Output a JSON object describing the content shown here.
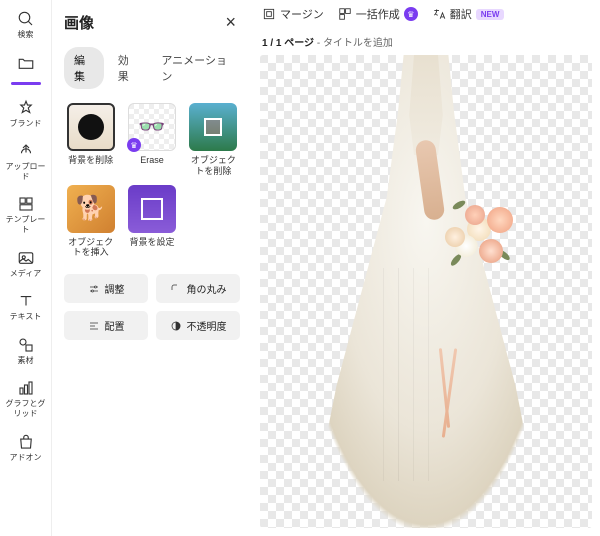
{
  "rail": {
    "items": [
      {
        "label": "検索"
      },
      {
        "label": ""
      },
      {
        "label": "ブランド"
      },
      {
        "label": "アップロード"
      },
      {
        "label": "テンプレート"
      },
      {
        "label": "メディア"
      },
      {
        "label": "テキスト"
      },
      {
        "label": "素材"
      },
      {
        "label": "グラフとグリッド"
      },
      {
        "label": "アドオン"
      }
    ]
  },
  "panel": {
    "title": "画像",
    "tabs": [
      {
        "label": "編集",
        "active": true
      },
      {
        "label": "効果",
        "active": false
      },
      {
        "label": "アニメーション",
        "active": false
      }
    ],
    "tools": [
      {
        "label": "背景を削除",
        "premium": false
      },
      {
        "label": "Erase",
        "premium": true
      },
      {
        "label": "オブジェクトを削除",
        "premium": false
      },
      {
        "label": "オブジェクトを挿入",
        "premium": false
      },
      {
        "label": "背景を設定",
        "premium": false
      }
    ],
    "buttons": {
      "adjust": "調整",
      "corner": "角の丸み",
      "align": "配置",
      "opacity": "不透明度"
    }
  },
  "topbar": {
    "margin": "マージン",
    "bulk": "一括作成",
    "translate": "翻訳",
    "new": "NEW"
  },
  "canvas": {
    "page_num": "1 / 1 ページ",
    "page_sep": " - ",
    "title_placeholder": "タイトルを追加"
  }
}
